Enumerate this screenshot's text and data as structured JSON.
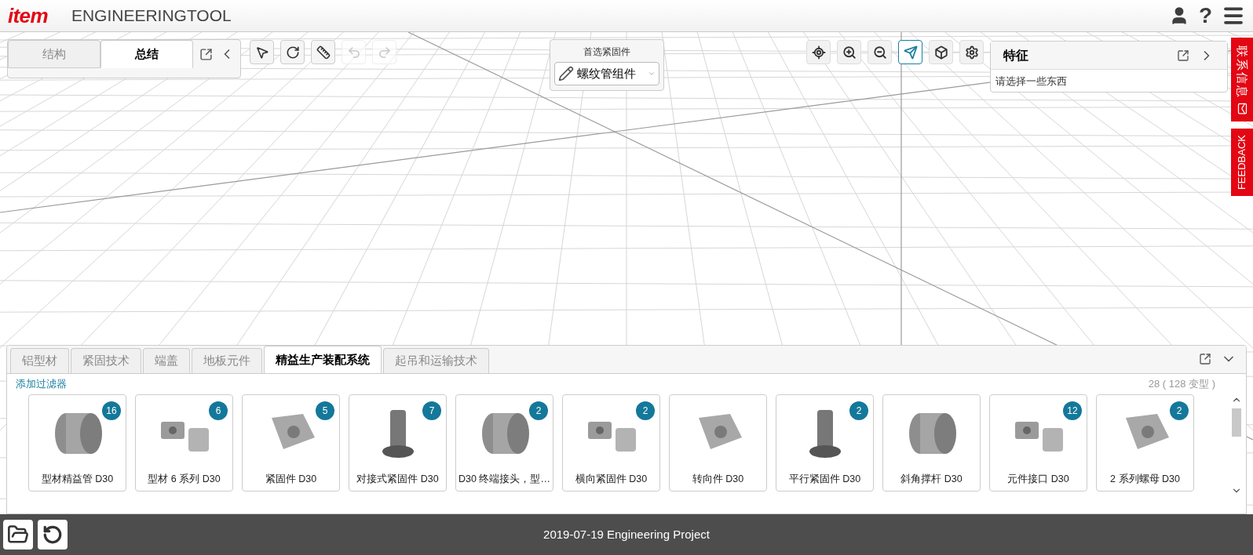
{
  "header": {
    "logo": "item",
    "title": "ENGINEERINGTOOL",
    "help": "?"
  },
  "left_panel": {
    "tabs": [
      {
        "label": "结构",
        "selected": false
      },
      {
        "label": "总结",
        "selected": true
      }
    ]
  },
  "edit_tools": [
    {
      "kind": "pointer",
      "disabled": false
    },
    {
      "kind": "rotate",
      "disabled": false
    },
    {
      "kind": "ruler",
      "disabled": false
    },
    {
      "kind": "undo",
      "disabled": true
    },
    {
      "kind": "redo",
      "disabled": true
    }
  ],
  "fastener": {
    "label": "首选紧固件",
    "value": "螺纹管组件"
  },
  "view_tools": [
    {
      "kind": "center",
      "selected": false
    },
    {
      "kind": "zoom_in",
      "selected": false
    },
    {
      "kind": "zoom_out",
      "selected": false
    },
    {
      "kind": "plane",
      "selected": true
    },
    {
      "kind": "block",
      "selected": false
    },
    {
      "kind": "settings",
      "selected": false
    }
  ],
  "feature_panel": {
    "title": "特征",
    "message": "请选择一些东西"
  },
  "side_tabs": [
    {
      "kind": "contact",
      "label": "联系信息"
    },
    {
      "kind": "feedback",
      "label": "FEEDBACK"
    }
  ],
  "catalog": {
    "tabs": [
      {
        "label": "铝型材",
        "selected": false
      },
      {
        "label": "紧固技术",
        "selected": false
      },
      {
        "label": "端盖",
        "selected": false
      },
      {
        "label": "地板元件",
        "selected": false
      },
      {
        "label": "精益生产装配系统",
        "selected": true
      },
      {
        "label": "起吊和运输技术",
        "selected": false
      }
    ],
    "filter_link": "添加过滤器",
    "count": "28 ( 128 变型 )",
    "items": [
      {
        "name": "型材精益管 D30",
        "badge": "16"
      },
      {
        "name": "型材 6 系列 D30",
        "badge": "6"
      },
      {
        "name": "紧固件 D30",
        "badge": "5"
      },
      {
        "name": "对接式紧固件 D30",
        "badge": "7"
      },
      {
        "name": "D30 终端接头，型…",
        "badge": "2"
      },
      {
        "name": "横向紧固件 D30",
        "badge": "2"
      },
      {
        "name": "转向件 D30"
      },
      {
        "name": "平行紧固件 D30",
        "badge": "2"
      },
      {
        "name": "斜角撑杆 D30"
      },
      {
        "name": "元件接口 D30",
        "badge": "12"
      },
      {
        "name": "2 系列螺母 D30",
        "badge": "2"
      }
    ]
  },
  "status_bar": {
    "project": "2019-07-19 Engineering Project"
  }
}
